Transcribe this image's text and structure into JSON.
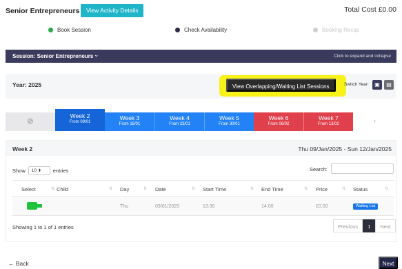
{
  "header": {
    "title": "Senior Entrepreneurs",
    "activity_button": "View Activity Details",
    "total_cost": "Total Cost £0.00"
  },
  "steps": [
    {
      "label": "Book Session",
      "color": "#2aa84a"
    },
    {
      "label": "Check Availability",
      "color": "#2b2b4a"
    },
    {
      "label": "Booking Recap",
      "color": "#cfcfcf"
    }
  ],
  "session": {
    "title": "Session: Senior Entrepreneurs",
    "chevron": "chevron-down-icon",
    "hint": "Click to expand and collapse"
  },
  "year": {
    "label": "Year: 2025",
    "overlap_button": "View Overlapping/Waiting List Sessions",
    "switch_label": "Switch Year:"
  },
  "weeks": [
    {
      "name": "",
      "from": "",
      "state": "disabled"
    },
    {
      "name": "Week 2",
      "from": "From 09/01",
      "state": "active"
    },
    {
      "name": "Week 3",
      "from": "From 16/01",
      "state": "available"
    },
    {
      "name": "Week 4",
      "from": "From 23/01",
      "state": "available"
    },
    {
      "name": "Week 5",
      "from": "From 30/01",
      "state": "available"
    },
    {
      "name": "Week 6",
      "from": "From 06/02",
      "state": "full"
    },
    {
      "name": "Week 7",
      "from": "From 13/02",
      "state": "full"
    },
    {
      "name": "›",
      "from": "",
      "state": "next"
    }
  ],
  "panel": {
    "week": "Week 2",
    "dates": "Thu 09/Jan/2025 - Sun 12/Jan/2025",
    "show_label": "Show",
    "entries_value": "10",
    "entries_label": "entries",
    "search_label": "Search:",
    "search_value": ""
  },
  "table": {
    "columns": [
      "Select",
      "Child",
      "Day",
      "Date",
      "Start Time",
      "End Time",
      "Price",
      "Status"
    ],
    "rows": [
      {
        "child": "",
        "day": "Thu",
        "date": "09/01/2025",
        "start": "13:30",
        "end": "14:00",
        "price": "£0.00",
        "status": "Waiting List"
      }
    ]
  },
  "footer": {
    "showing": "Showing 1 to 1 of 1 entries",
    "previous": "Previous",
    "page": "1",
    "next": "Next"
  },
  "nav": {
    "back": "← Back",
    "next": "Next"
  },
  "colors": {
    "accent": "#1fb5c9",
    "session_bar": "#3a3a5c",
    "highlight": "#f7f21a",
    "week_active": "#1565d8",
    "week_available": "#2382f5",
    "week_full": "#e0404c",
    "status": "#1976e8",
    "select": "#22c33c"
  }
}
